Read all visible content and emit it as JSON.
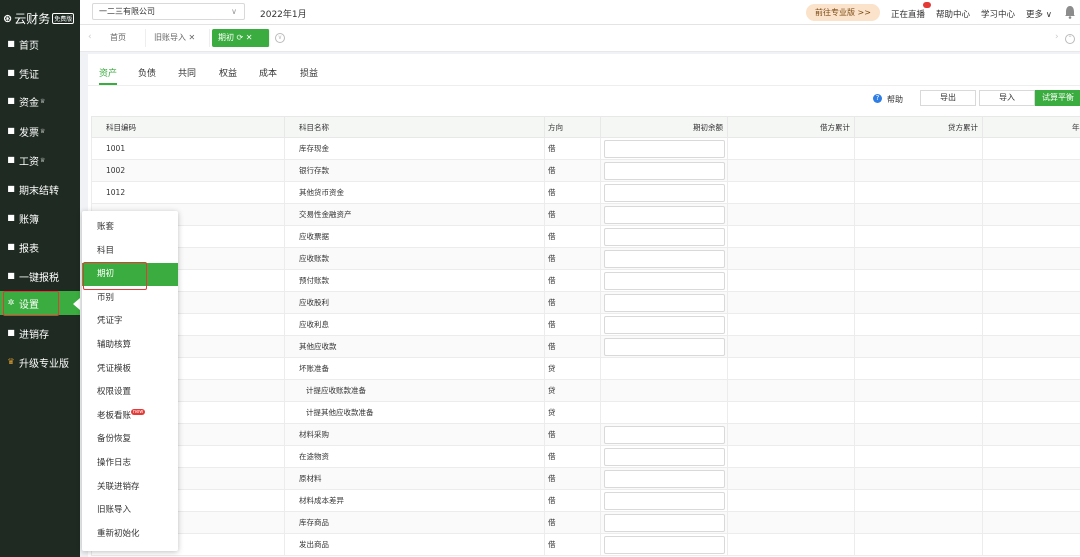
{
  "app": {
    "logo_text": "云财务",
    "edition_badge": "免费版"
  },
  "sidebar": {
    "items": [
      {
        "label": "首页",
        "icon": "home-icon",
        "crown": false
      },
      {
        "label": "凭证",
        "icon": "voucher-icon",
        "crown": false
      },
      {
        "label": "资金",
        "icon": "fund-icon",
        "crown": true
      },
      {
        "label": "发票",
        "icon": "invoice-icon",
        "crown": true
      },
      {
        "label": "工资",
        "icon": "salary-icon",
        "crown": true
      },
      {
        "label": "期末结转",
        "icon": "period-end-icon",
        "crown": false
      },
      {
        "label": "账簿",
        "icon": "ledger-icon",
        "crown": false
      },
      {
        "label": "报表",
        "icon": "report-icon",
        "crown": false
      },
      {
        "label": "一键报税",
        "icon": "tax-icon",
        "crown": false
      },
      {
        "label": "设置",
        "icon": "gear-icon",
        "crown": false
      },
      {
        "label": "进销存",
        "icon": "inventory-icon",
        "crown": false
      },
      {
        "label": "升级专业版",
        "icon": "crown-icon",
        "crown": false
      }
    ]
  },
  "header": {
    "company": "一二三有限公司",
    "period": "2022年1月",
    "pro_button": "前往专业版 >>",
    "links": [
      "正在直播",
      "帮助中心",
      "学习中心",
      "更多"
    ]
  },
  "tabs": [
    {
      "label": "首页"
    },
    {
      "label": "旧账导入"
    },
    {
      "label": "期初"
    }
  ],
  "subtabs": [
    "资产",
    "负债",
    "共同",
    "权益",
    "成本",
    "损益"
  ],
  "actions": {
    "help": "帮助",
    "export": "导出",
    "import": "导入",
    "trial_balance": "试算平衡"
  },
  "table": {
    "headers": [
      "科目编码",
      "科目名称",
      "方向",
      "期初余额",
      "借方累计",
      "贷方累计",
      "年初"
    ],
    "rows": [
      {
        "code": "1001",
        "name": "库存现金",
        "dir": "借",
        "input": true
      },
      {
        "code": "1002",
        "name": "银行存款",
        "dir": "借",
        "input": true
      },
      {
        "code": "1012",
        "name": "其他货币资金",
        "dir": "借",
        "input": true
      },
      {
        "code": "",
        "name": "交易性金融资产",
        "dir": "借",
        "input": true
      },
      {
        "code": "",
        "name": "应收票据",
        "dir": "借",
        "input": true
      },
      {
        "code": "",
        "name": "应收账款",
        "dir": "借",
        "input": true
      },
      {
        "code": "",
        "name": "预付账款",
        "dir": "借",
        "input": true
      },
      {
        "code": "",
        "name": "应收股利",
        "dir": "借",
        "input": true
      },
      {
        "code": "",
        "name": "应收利息",
        "dir": "借",
        "input": true
      },
      {
        "code": "",
        "name": "其他应收款",
        "dir": "借",
        "input": true
      },
      {
        "code": "",
        "name": "坏账准备",
        "dir": "贷",
        "input": false
      },
      {
        "code": "",
        "name": "计提应收账款准备",
        "dir": "贷",
        "input": false,
        "indent": true
      },
      {
        "code": "",
        "name": "计提其他应收款准备",
        "dir": "贷",
        "input": false,
        "indent": true
      },
      {
        "code": "",
        "name": "材料采购",
        "dir": "借",
        "input": true
      },
      {
        "code": "",
        "name": "在途物资",
        "dir": "借",
        "input": true
      },
      {
        "code": "",
        "name": "原材料",
        "dir": "借",
        "input": true
      },
      {
        "code": "",
        "name": "材料成本差异",
        "dir": "借",
        "input": true
      },
      {
        "code": "",
        "name": "库存商品",
        "dir": "借",
        "input": true
      },
      {
        "code": "",
        "name": "发出商品",
        "dir": "借",
        "input": true
      }
    ]
  },
  "settings_menu": {
    "items": [
      "账套",
      "科目",
      "期初",
      "币别",
      "凭证字",
      "辅助核算",
      "凭证模板",
      "权限设置",
      "老板看账",
      "备份恢复",
      "操作日志",
      "关联进销存",
      "旧账导入",
      "重新初始化"
    ],
    "active_index": 2,
    "badge_index": 8,
    "badge_text": "new"
  },
  "colors": {
    "sidebar_bg": "#1e2a22",
    "accent": "#3bac3f",
    "highlight": "#e53935"
  }
}
